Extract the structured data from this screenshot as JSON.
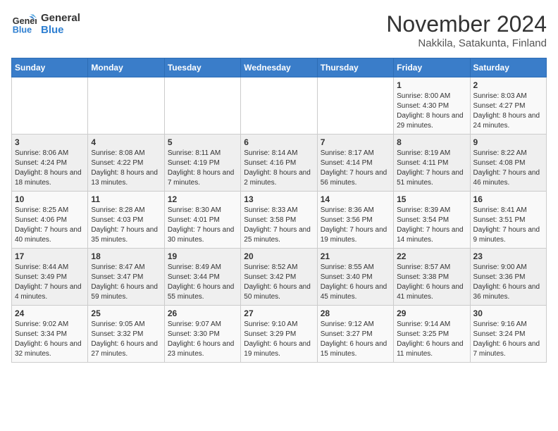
{
  "logo": {
    "line1": "General",
    "line2": "Blue"
  },
  "title": "November 2024",
  "subtitle": "Nakkila, Satakunta, Finland",
  "days_header": [
    "Sunday",
    "Monday",
    "Tuesday",
    "Wednesday",
    "Thursday",
    "Friday",
    "Saturday"
  ],
  "weeks": [
    [
      {
        "day": "",
        "info": ""
      },
      {
        "day": "",
        "info": ""
      },
      {
        "day": "",
        "info": ""
      },
      {
        "day": "",
        "info": ""
      },
      {
        "day": "",
        "info": ""
      },
      {
        "day": "1",
        "info": "Sunrise: 8:00 AM\nSunset: 4:30 PM\nDaylight: 8 hours and 29 minutes."
      },
      {
        "day": "2",
        "info": "Sunrise: 8:03 AM\nSunset: 4:27 PM\nDaylight: 8 hours and 24 minutes."
      }
    ],
    [
      {
        "day": "3",
        "info": "Sunrise: 8:06 AM\nSunset: 4:24 PM\nDaylight: 8 hours and 18 minutes."
      },
      {
        "day": "4",
        "info": "Sunrise: 8:08 AM\nSunset: 4:22 PM\nDaylight: 8 hours and 13 minutes."
      },
      {
        "day": "5",
        "info": "Sunrise: 8:11 AM\nSunset: 4:19 PM\nDaylight: 8 hours and 7 minutes."
      },
      {
        "day": "6",
        "info": "Sunrise: 8:14 AM\nSunset: 4:16 PM\nDaylight: 8 hours and 2 minutes."
      },
      {
        "day": "7",
        "info": "Sunrise: 8:17 AM\nSunset: 4:14 PM\nDaylight: 7 hours and 56 minutes."
      },
      {
        "day": "8",
        "info": "Sunrise: 8:19 AM\nSunset: 4:11 PM\nDaylight: 7 hours and 51 minutes."
      },
      {
        "day": "9",
        "info": "Sunrise: 8:22 AM\nSunset: 4:08 PM\nDaylight: 7 hours and 46 minutes."
      }
    ],
    [
      {
        "day": "10",
        "info": "Sunrise: 8:25 AM\nSunset: 4:06 PM\nDaylight: 7 hours and 40 minutes."
      },
      {
        "day": "11",
        "info": "Sunrise: 8:28 AM\nSunset: 4:03 PM\nDaylight: 7 hours and 35 minutes."
      },
      {
        "day": "12",
        "info": "Sunrise: 8:30 AM\nSunset: 4:01 PM\nDaylight: 7 hours and 30 minutes."
      },
      {
        "day": "13",
        "info": "Sunrise: 8:33 AM\nSunset: 3:58 PM\nDaylight: 7 hours and 25 minutes."
      },
      {
        "day": "14",
        "info": "Sunrise: 8:36 AM\nSunset: 3:56 PM\nDaylight: 7 hours and 19 minutes."
      },
      {
        "day": "15",
        "info": "Sunrise: 8:39 AM\nSunset: 3:54 PM\nDaylight: 7 hours and 14 minutes."
      },
      {
        "day": "16",
        "info": "Sunrise: 8:41 AM\nSunset: 3:51 PM\nDaylight: 7 hours and 9 minutes."
      }
    ],
    [
      {
        "day": "17",
        "info": "Sunrise: 8:44 AM\nSunset: 3:49 PM\nDaylight: 7 hours and 4 minutes."
      },
      {
        "day": "18",
        "info": "Sunrise: 8:47 AM\nSunset: 3:47 PM\nDaylight: 6 hours and 59 minutes."
      },
      {
        "day": "19",
        "info": "Sunrise: 8:49 AM\nSunset: 3:44 PM\nDaylight: 6 hours and 55 minutes."
      },
      {
        "day": "20",
        "info": "Sunrise: 8:52 AM\nSunset: 3:42 PM\nDaylight: 6 hours and 50 minutes."
      },
      {
        "day": "21",
        "info": "Sunrise: 8:55 AM\nSunset: 3:40 PM\nDaylight: 6 hours and 45 minutes."
      },
      {
        "day": "22",
        "info": "Sunrise: 8:57 AM\nSunset: 3:38 PM\nDaylight: 6 hours and 41 minutes."
      },
      {
        "day": "23",
        "info": "Sunrise: 9:00 AM\nSunset: 3:36 PM\nDaylight: 6 hours and 36 minutes."
      }
    ],
    [
      {
        "day": "24",
        "info": "Sunrise: 9:02 AM\nSunset: 3:34 PM\nDaylight: 6 hours and 32 minutes."
      },
      {
        "day": "25",
        "info": "Sunrise: 9:05 AM\nSunset: 3:32 PM\nDaylight: 6 hours and 27 minutes."
      },
      {
        "day": "26",
        "info": "Sunrise: 9:07 AM\nSunset: 3:30 PM\nDaylight: 6 hours and 23 minutes."
      },
      {
        "day": "27",
        "info": "Sunrise: 9:10 AM\nSunset: 3:29 PM\nDaylight: 6 hours and 19 minutes."
      },
      {
        "day": "28",
        "info": "Sunrise: 9:12 AM\nSunset: 3:27 PM\nDaylight: 6 hours and 15 minutes."
      },
      {
        "day": "29",
        "info": "Sunrise: 9:14 AM\nSunset: 3:25 PM\nDaylight: 6 hours and 11 minutes."
      },
      {
        "day": "30",
        "info": "Sunrise: 9:16 AM\nSunset: 3:24 PM\nDaylight: 6 hours and 7 minutes."
      }
    ]
  ]
}
